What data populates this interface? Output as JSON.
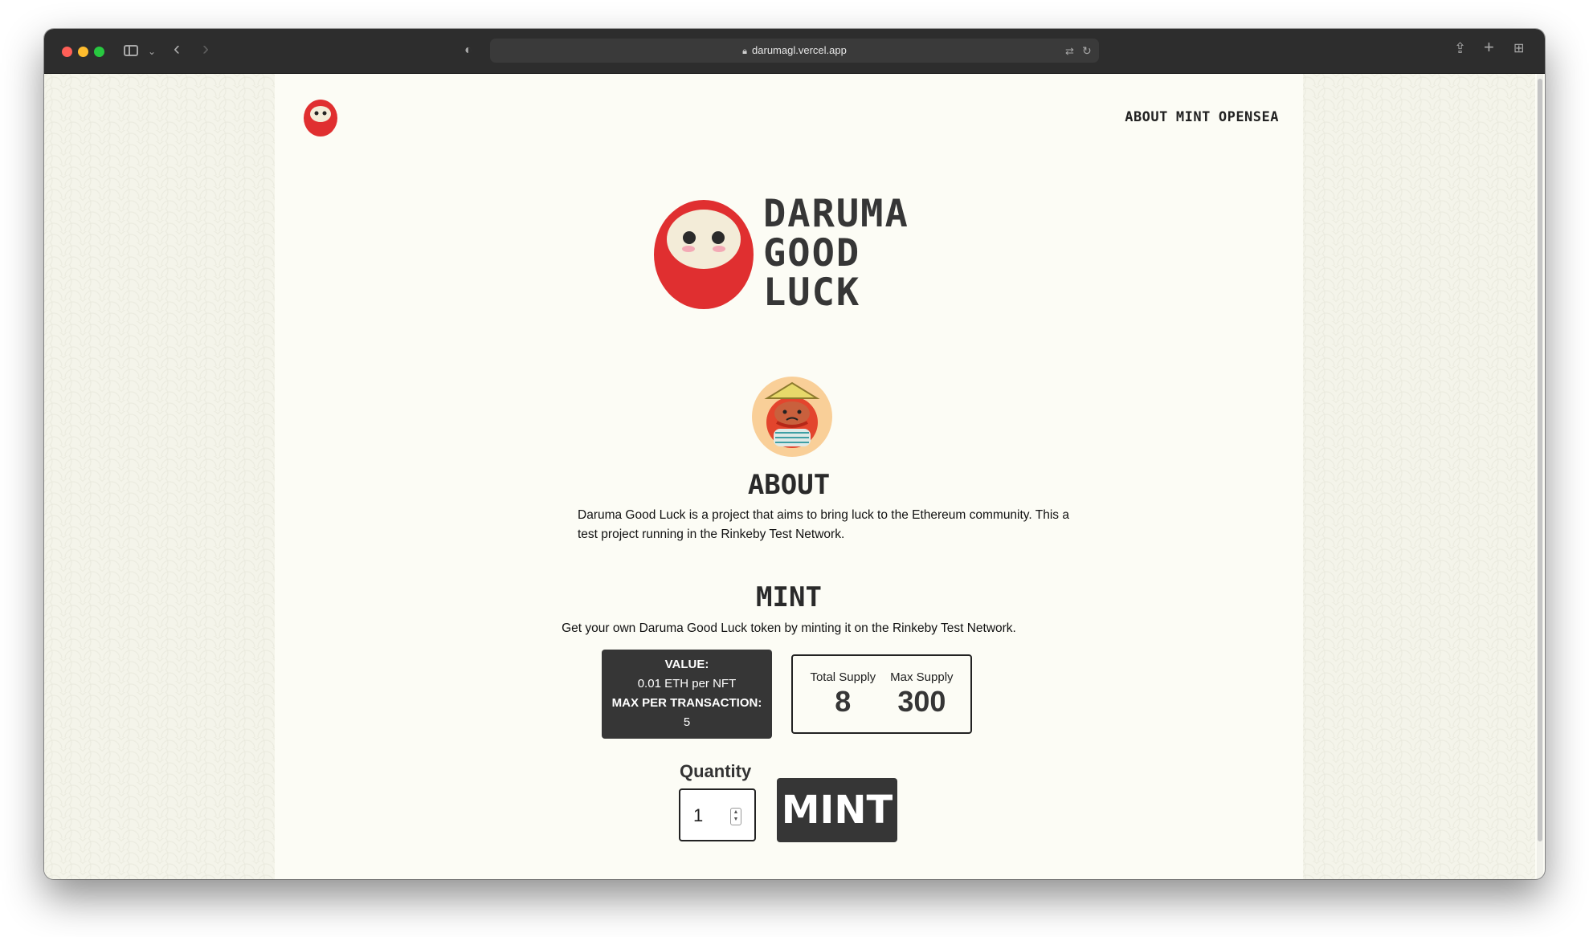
{
  "browser": {
    "url": "darumagl.vercel.app"
  },
  "nav": {
    "about": "ABOUT",
    "mint": "MINT",
    "opensea": "OPENSEA"
  },
  "hero": {
    "title_line1": "DARUMA",
    "title_line2": "GOOD",
    "title_line3": "LUCK"
  },
  "about": {
    "heading": "ABOUT",
    "text": "Daruma Good Luck is a project that aims to bring luck to the Ethereum community. This a test project running in the Rinkeby Test Network."
  },
  "mint": {
    "heading": "MINT",
    "description": "Get your own Daruma Good Luck token by minting it on the Rinkeby Test Network.",
    "value_label": "VALUE:",
    "value": "0.01 ETH per NFT",
    "max_label": "MAX PER TRANSACTION:",
    "max_value": "5",
    "total_supply_label": "Total Supply",
    "total_supply": "8",
    "max_supply_label": "Max Supply",
    "max_supply": "300",
    "quantity_label": "Quantity",
    "quantity_value": "1",
    "button_label": "MINT"
  },
  "colors": {
    "daruma_red": "#e02f30",
    "dark": "#363636",
    "page_bg": "#fcfcf5"
  },
  "icons": [
    "sidebar-icon",
    "back-icon",
    "forward-icon",
    "shield-icon",
    "lock-icon",
    "translate-icon",
    "reload-icon",
    "share-icon",
    "new-tab-icon",
    "tab-overview-icon"
  ]
}
